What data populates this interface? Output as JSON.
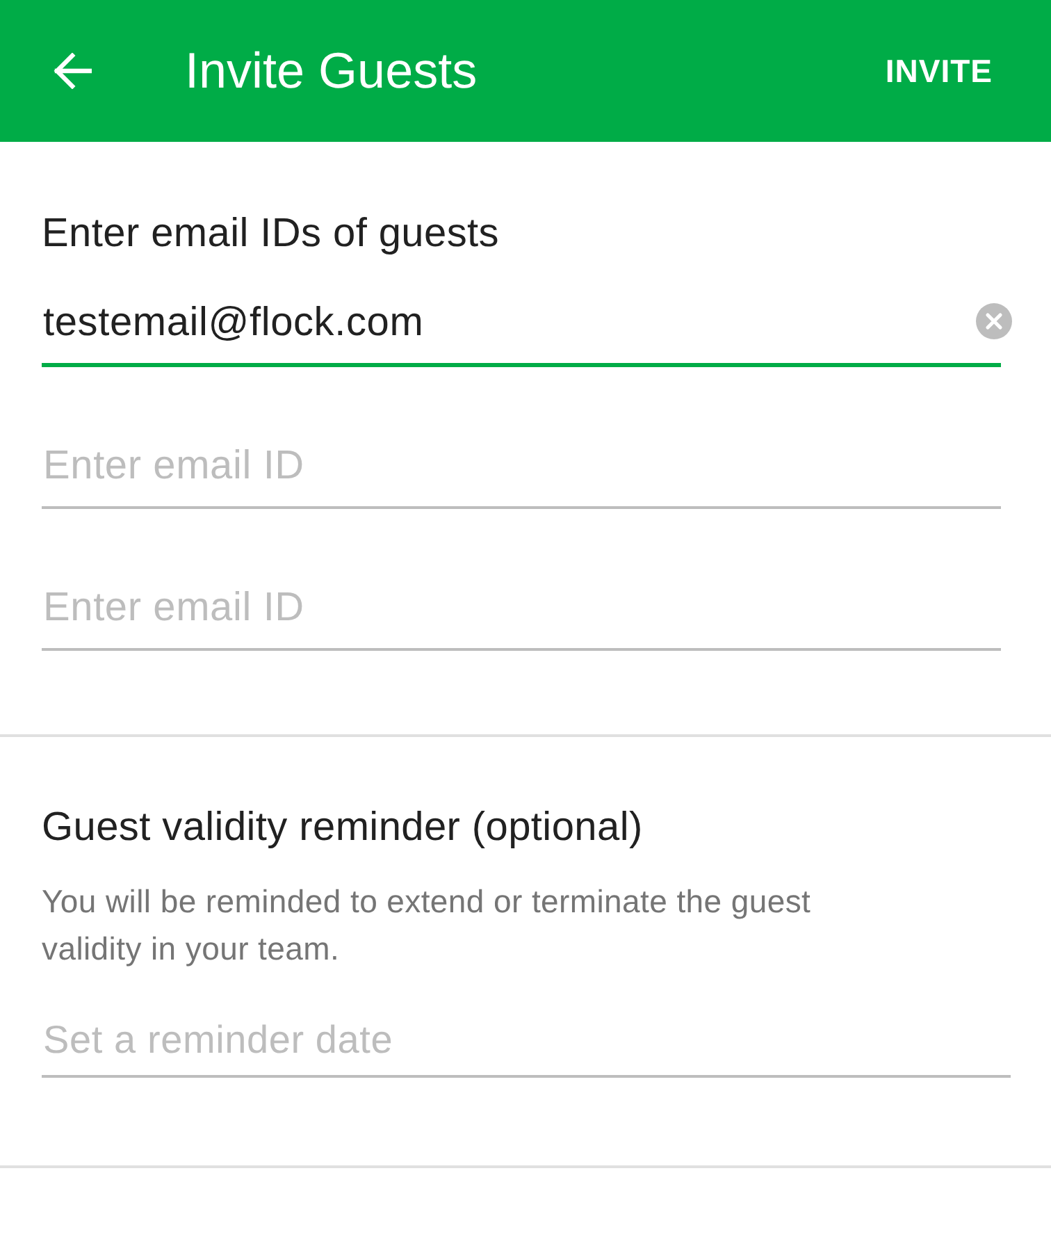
{
  "app_bar": {
    "title": "Invite Guests",
    "action": "INVITE"
  },
  "guests": {
    "label": "Enter email IDs of guests",
    "fields": [
      {
        "value": "testemail@flock.com",
        "focused": true
      },
      {
        "placeholder": "Enter email ID",
        "focused": false
      },
      {
        "placeholder": "Enter email ID",
        "focused": false
      }
    ]
  },
  "reminder": {
    "title": "Guest validity reminder (optional)",
    "description": "You will be reminded to extend or terminate the guest validity in your team.",
    "field": {
      "placeholder": "Set a reminder date"
    }
  }
}
